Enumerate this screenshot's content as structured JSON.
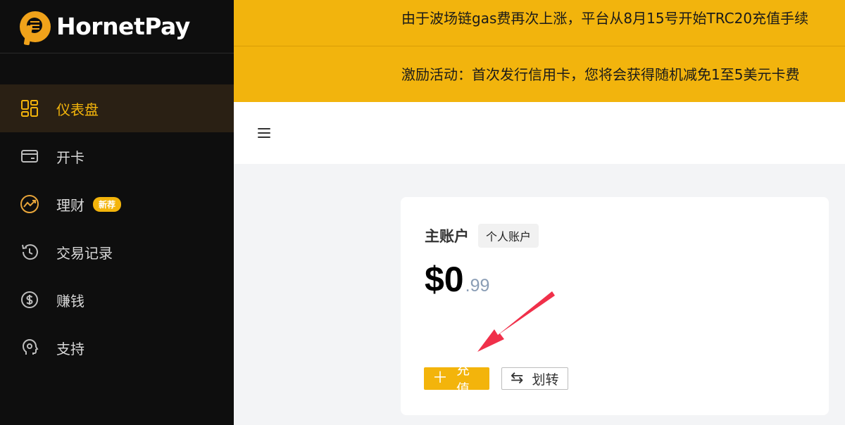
{
  "brand": {
    "name": "HornetPay"
  },
  "sidebar": {
    "items": [
      {
        "label": "仪表盘",
        "icon": "dashboard-icon",
        "active": true
      },
      {
        "label": "开卡",
        "icon": "card-icon"
      },
      {
        "label": "理财",
        "icon": "trend-icon",
        "badge": "新荐"
      },
      {
        "label": "交易记录",
        "icon": "history-icon"
      },
      {
        "label": "赚钱",
        "icon": "dollar-icon"
      },
      {
        "label": "支持",
        "icon": "support-icon"
      }
    ]
  },
  "notices": [
    "由于波场链gas费再次上涨，平台从8月15号开始TRC20充值手续",
    "激励活动：首次发行信用卡，您将会获得随机减免1至5美元卡费"
  ],
  "account": {
    "title": "主账户",
    "tag": "个人账户",
    "balance_main": "$0",
    "balance_cents": ".99"
  },
  "buttons": {
    "deposit": "充值",
    "transfer": "划转"
  },
  "colors": {
    "accent": "#f3b40b",
    "sidebar_bg": "#0e0e0e",
    "annotation_arrow": "#f0304a"
  }
}
